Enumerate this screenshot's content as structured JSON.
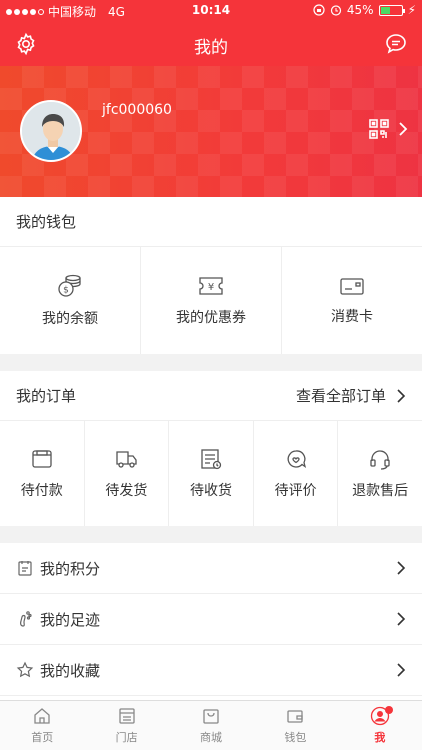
{
  "status_bar": {
    "carrier": "中国移动",
    "network": "4G",
    "time": "10:14",
    "battery": "45%",
    "battery_level": 0.45
  },
  "header": {
    "title": "我的"
  },
  "profile": {
    "username": "jfc000060"
  },
  "wallet": {
    "title": "我的钱包",
    "items": [
      {
        "label": "我的余额",
        "icon": "coins-icon"
      },
      {
        "label": "我的优惠券",
        "icon": "coupon-icon"
      },
      {
        "label": "消费卡",
        "icon": "card-icon"
      }
    ]
  },
  "orders": {
    "title": "我的订单",
    "view_all": "查看全部订单",
    "items": [
      {
        "label": "待付款",
        "icon": "wallet-icon"
      },
      {
        "label": "待发货",
        "icon": "truck-icon"
      },
      {
        "label": "待收货",
        "icon": "receipt-icon"
      },
      {
        "label": "待评价",
        "icon": "review-icon"
      },
      {
        "label": "退款售后",
        "icon": "headset-icon"
      }
    ]
  },
  "menu": [
    {
      "label": "我的积分",
      "icon": "points-icon"
    },
    {
      "label": "我的足迹",
      "icon": "footprint-icon"
    },
    {
      "label": "我的收藏",
      "icon": "star-icon"
    }
  ],
  "tabbar": [
    {
      "label": "首页",
      "icon": "home-icon"
    },
    {
      "label": "门店",
      "icon": "store-icon"
    },
    {
      "label": "商城",
      "icon": "bag-icon"
    },
    {
      "label": "钱包",
      "icon": "wallet-icon"
    },
    {
      "label": "我",
      "icon": "user-icon",
      "active": true
    }
  ],
  "colors": {
    "accent": "#f5343a"
  }
}
